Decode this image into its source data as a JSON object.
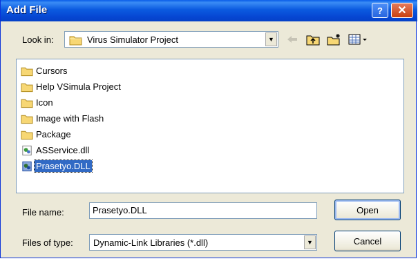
{
  "window": {
    "title": "Add File",
    "help_label": "?",
    "close_label": "✕"
  },
  "lookin": {
    "label": "Look in:",
    "value": "Virus Simulator Project"
  },
  "toolbar": {
    "back_icon": "back-arrow-icon",
    "up_icon": "up-folder-icon",
    "new_folder_icon": "new-folder-icon",
    "views_icon": "views-menu-icon"
  },
  "files": [
    {
      "name": "Cursors",
      "type": "folder"
    },
    {
      "name": "Help VSimula Project",
      "type": "folder"
    },
    {
      "name": "Icon",
      "type": "folder"
    },
    {
      "name": "Image with Flash",
      "type": "folder"
    },
    {
      "name": "Package",
      "type": "folder"
    },
    {
      "name": "ASService.dll",
      "type": "dll"
    },
    {
      "name": "Prasetyo.DLL",
      "type": "dll",
      "selected": true
    }
  ],
  "filename": {
    "label": "File name:",
    "value": "Prasetyo.DLL"
  },
  "filetype": {
    "label": "Files of type:",
    "value": "Dynamic-Link Libraries (*.dll)"
  },
  "buttons": {
    "open": "Open",
    "cancel": "Cancel"
  },
  "colors": {
    "title_blue": "#0646d2",
    "selection": "#316ac5",
    "dialog_bg": "#ece9d8"
  }
}
